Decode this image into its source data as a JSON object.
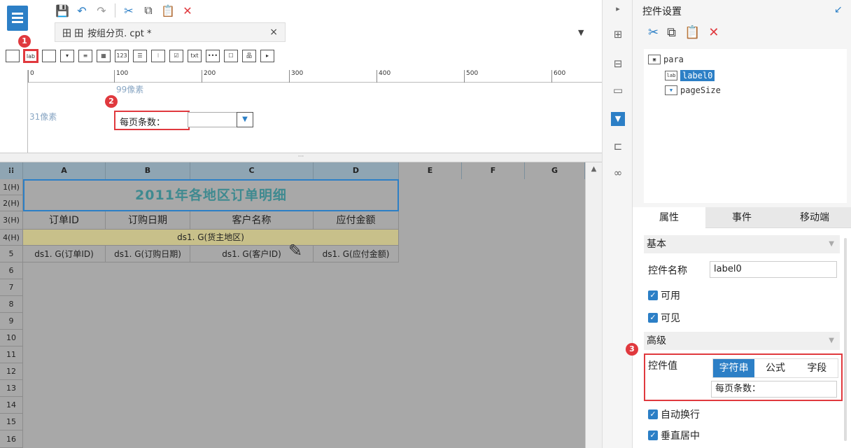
{
  "toolbar": {
    "icons": [
      "save-icon",
      "undo-icon",
      "redo-icon",
      "cut-icon",
      "copy-icon",
      "paste-icon",
      "delete-icon"
    ]
  },
  "tab": {
    "icons_text": "田 田",
    "label": "按组分页. cpt *",
    "close": "×"
  },
  "widget_bar": {
    "badge1": "1",
    "selected_label": "lab",
    "txt": "txt",
    "num": "123"
  },
  "ruler": {
    "ticks": [
      "0",
      "100",
      "200",
      "300",
      "400",
      "500",
      "600"
    ]
  },
  "param": {
    "guide_width": "99像素",
    "guide_height": "31像素",
    "badge2": "2",
    "label_text": "每页条数："
  },
  "grid": {
    "columns": [
      "A",
      "B",
      "C",
      "D",
      "E",
      "F",
      "G"
    ],
    "rows": [
      "1(H)",
      "2(H)",
      "3(H)",
      "4(H)",
      "5",
      "6",
      "7",
      "8",
      "9",
      "10",
      "11",
      "12",
      "13",
      "14",
      "15",
      "16"
    ],
    "title": "2011年各地区订单明细",
    "headers": [
      "订单ID",
      "订购日期",
      "客户名称",
      "应付金额"
    ],
    "group_row": "ds1. G(货主地区)",
    "detail": [
      "ds1. G(订单ID)",
      "ds1. G(订购日期)",
      "ds1. G(客户ID)",
      "ds1. G(应付金额)"
    ]
  },
  "panel": {
    "title": "控件设置",
    "tree": {
      "root": "para",
      "item1": "label0",
      "item2": "pageSize"
    },
    "tabs": [
      "属性",
      "事件",
      "移动端"
    ],
    "basic": "基本",
    "name_label": "控件名称",
    "name_value": "label0",
    "enabled": "可用",
    "visible": "可见",
    "advanced": "高级",
    "badge3": "3",
    "value_label": "控件值",
    "value_modes": [
      "字符串",
      "公式",
      "字段"
    ],
    "value_text": "每页条数：",
    "auto_wrap": "自动换行",
    "vcenter": "垂直居中"
  },
  "colors": {
    "accent": "#2c7fc6",
    "highlight": "#e0393e",
    "title": "#3f8a90"
  }
}
